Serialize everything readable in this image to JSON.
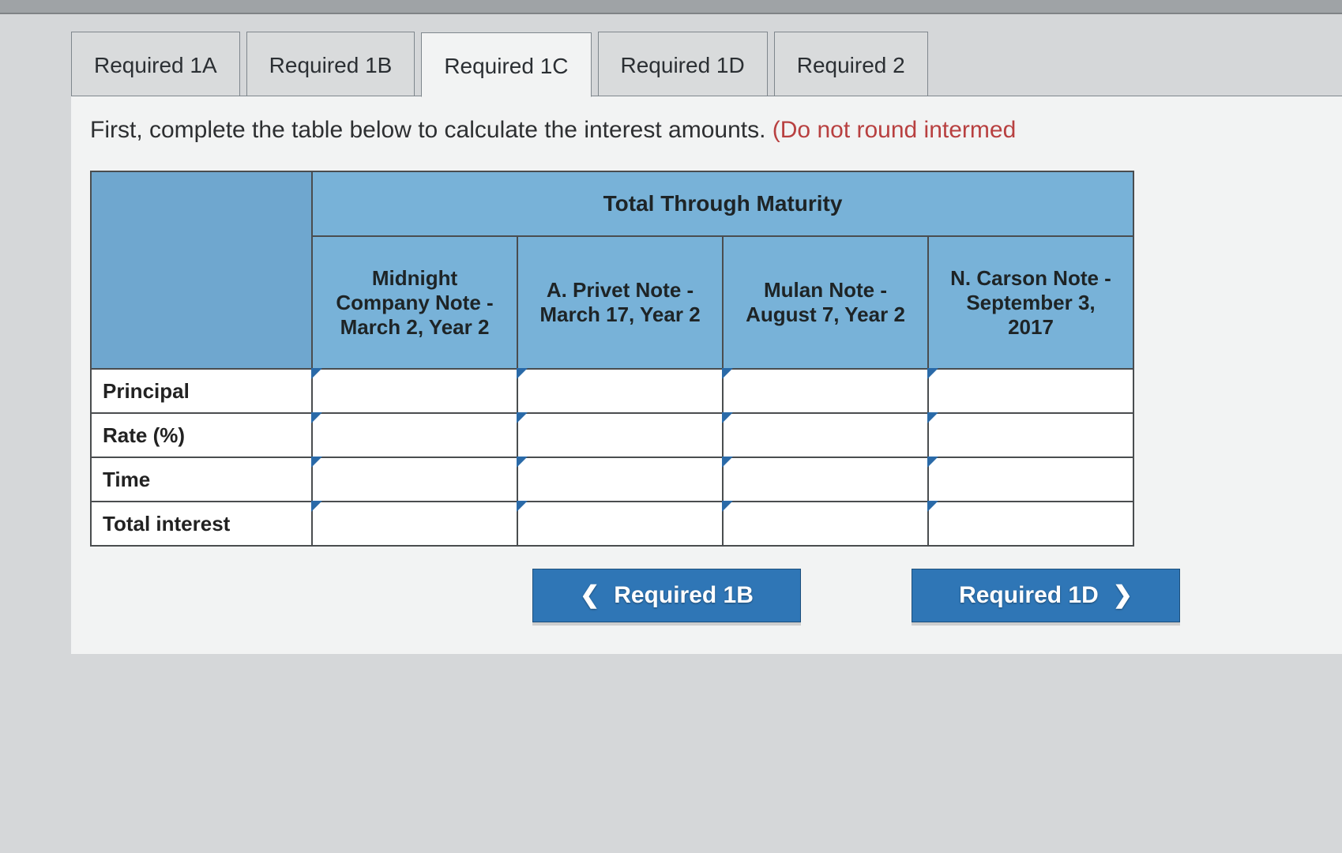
{
  "tabs": [
    {
      "label": "Required 1A",
      "active": false
    },
    {
      "label": "Required 1B",
      "active": false
    },
    {
      "label": "Required 1C",
      "active": true
    },
    {
      "label": "Required 1D",
      "active": false
    },
    {
      "label": "Required 2",
      "active": false
    }
  ],
  "instruction": {
    "main": "First, complete the table below to calculate the interest amounts. ",
    "note": "(Do not round intermed"
  },
  "table": {
    "top_header": "Total Through Maturity",
    "columns": [
      "Midnight Company Note - March 2, Year 2",
      "A. Privet Note - March 17, Year 2",
      "Mulan Note - August 7, Year 2",
      "N. Carson Note - September 3, 2017"
    ],
    "rows": [
      {
        "label": "Principal",
        "values": [
          "",
          "",
          "",
          ""
        ]
      },
      {
        "label": "Rate (%)",
        "values": [
          "",
          "",
          "",
          ""
        ]
      },
      {
        "label": "Time",
        "values": [
          "",
          "",
          "",
          ""
        ]
      },
      {
        "label": "Total interest",
        "values": [
          "",
          "",
          "",
          ""
        ]
      }
    ]
  },
  "nav": {
    "prev_label": "Required 1B",
    "next_label": "Required 1D"
  }
}
